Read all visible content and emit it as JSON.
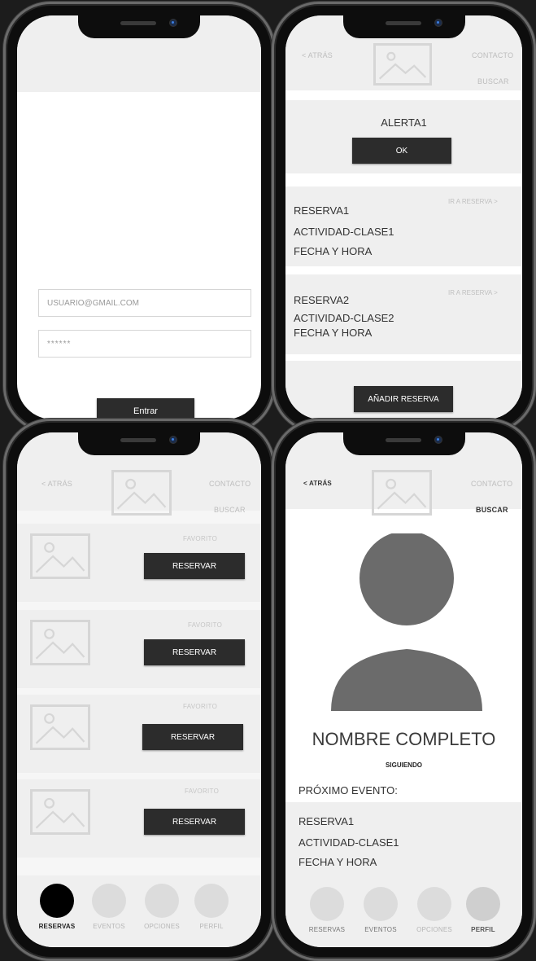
{
  "login": {
    "email_value": "USUARIO@GMAIL.COM",
    "password_value": "******",
    "submit_label": "Entrar"
  },
  "header": {
    "back_label": "< ATRÁS",
    "contact_label": "CONTACTO",
    "search_label": "BUSCAR"
  },
  "reservations_screen": {
    "alert_title": "ALERTA1",
    "alert_ok_label": "OK",
    "items": [
      {
        "title": "RESERVA1",
        "activity": "ACTIVIDAD-CLASE1",
        "datetime": "FECHA Y HORA",
        "link": "IR A RESERVA >"
      },
      {
        "title": "RESERVA2",
        "activity": "ACTIVIDAD-CLASE2",
        "datetime": "FECHA Y HORA",
        "link": "IR A RESERVA >"
      }
    ],
    "add_button_label": "AÑADIR RESERVA"
  },
  "listing_screen": {
    "items": [
      {
        "favorite_label": "FAVORITO",
        "reserve_label": "RESERVAR"
      },
      {
        "favorite_label": "FAVORITO",
        "reserve_label": "RESERVAR"
      },
      {
        "favorite_label": "FAVORITO",
        "reserve_label": "RESERVAR"
      },
      {
        "favorite_label": "FAVORITO",
        "reserve_label": "RESERVAR"
      }
    ],
    "tabs": [
      "RESERVAS",
      "EVENTOS",
      "OPCIONES",
      "PERFIL"
    ]
  },
  "profile_screen": {
    "name": "NOMBRE COMPLETO",
    "following_label": "SIGUIENDO",
    "next_event_label": "PRÓXIMO EVENTO:",
    "event": {
      "title": "RESERVA1",
      "activity": "ACTIVIDAD-CLASE1",
      "datetime": "FECHA Y HORA"
    },
    "tabs": [
      "RESERVAS",
      "EVENTOS",
      "OPCIONES",
      "PERFIL"
    ]
  },
  "colors": {
    "dark_button": "#2c2c2c",
    "panel_gray": "#efefef",
    "avatar_gray": "#6b6b6b",
    "active_tab": "#000000"
  },
  "icons": [
    "image-placeholder-icon",
    "avatar-icon",
    "camera-icon"
  ]
}
